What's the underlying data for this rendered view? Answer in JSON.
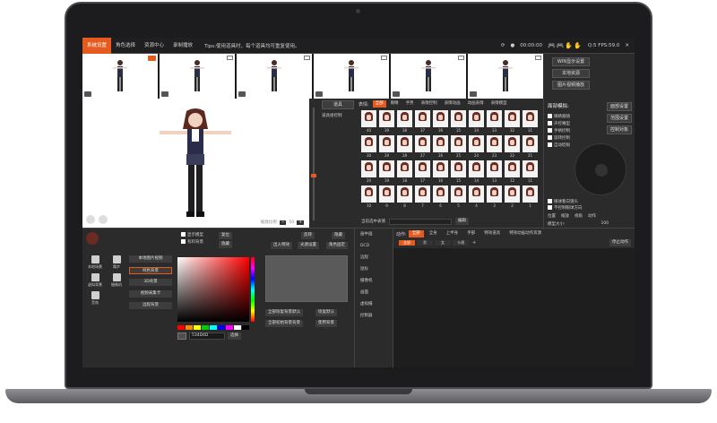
{
  "topbar": {
    "tabs": [
      "系统设置",
      "角色选择",
      "资源中心",
      "录制播放"
    ],
    "tips": "Tips:使用道具时，每个道具均可重复使用。",
    "time": "00:00:00",
    "stats": "Q:5 FPS:59.0",
    "close": "✕"
  },
  "right_top": {
    "btn1": "WIN显示设置",
    "btn2": "本地资源",
    "btn3": "图片视频播放"
  },
  "preview": {
    "zoom_label": "缩放比例",
    "zoom_value": "50",
    "minus": "−",
    "plus": "+"
  },
  "props": {
    "header": "道具",
    "item1": "道具组控制"
  },
  "expression": {
    "label": "表情:",
    "tabs": [
      "全部",
      "眼睛",
      "手势",
      "表情控制",
      "表情动画",
      "动画表情",
      "表情模型"
    ],
    "numbers": [
      40,
      39,
      38,
      37,
      36,
      35,
      34,
      33,
      32,
      31,
      30,
      29,
      28,
      27,
      26,
      25,
      24,
      23,
      22,
      21,
      20,
      19,
      18,
      17,
      16,
      15,
      14,
      13,
      12,
      11,
      10,
      9,
      8,
      7,
      6,
      5,
      4,
      3,
      2,
      1
    ],
    "search_label": "当前选中表情",
    "edit_btn": "编辑"
  },
  "face_panel": {
    "title": "面部模拟:",
    "btn_settings": "面部设置",
    "btn_reset": "范围设置",
    "btn_control": "控制对象",
    "checks": [
      "眼睛跟随",
      "声控嘴型",
      "手柄控制",
      "旋转控制",
      "自动眨眼"
    ],
    "check_follow": "眼球看向镜头",
    "check_stand": "不控制眼球方向",
    "row_labels": [
      "位置",
      "缩放",
      "视角",
      "动作"
    ],
    "value_label": "模型大小:",
    "value": "100"
  },
  "bottom_left": {
    "check1": "显示模型",
    "check2": "有料背景",
    "btn_reset": "复位",
    "btn_hide": "隐藏",
    "btn_reverse": "反转",
    "btn_hide2": "隐藏",
    "btn_in": "出入特效",
    "btn_light": "光源设置",
    "btn_pos": "角色固定",
    "side_icons": [
      "本地场景",
      "舞步",
      "虚拟背景",
      "摄像机",
      "音效"
    ],
    "bg_list": [
      "本地图片视频",
      "纯色背景",
      "3D背景",
      "视频采集卡",
      "远程背景"
    ],
    "hex": "534D4D",
    "pick_btn": "选择",
    "btn_default1": "全部恢复背景默认",
    "btn_default2": "恢复默认",
    "btn_cur": "全部初始背景背景",
    "btn_use": "使用背景",
    "mid_list": [
      "画中画",
      "DCD",
      "远程",
      "鼠标",
      "摄像机",
      "画面",
      "虚拟摄",
      "控制器"
    ]
  },
  "motion": {
    "label": "动作:",
    "tabs": [
      "全部",
      "全身",
      "上半身",
      "手部",
      "特效道具",
      "特效动画动作资源"
    ],
    "stop_btn": "停止动作",
    "sub_tabs": [
      "全部",
      "男",
      "女",
      "卡通"
    ],
    "add": "+"
  },
  "colors": {
    "accent": "#e65a1e",
    "icons_red": "#e23b3b"
  }
}
